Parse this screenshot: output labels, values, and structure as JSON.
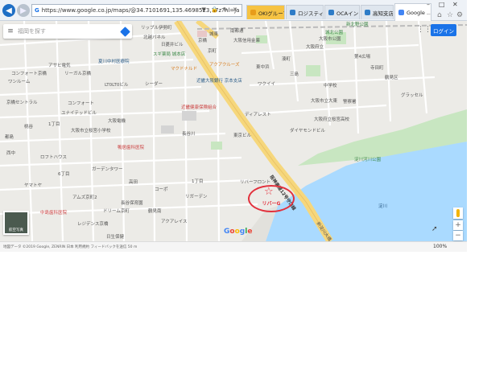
{
  "browser": {
    "url": "https://www.google.co.jp/maps/@34.7101691,135.4698523,17z?hl=ja",
    "tabs": [
      {
        "label": "OKIグループ...",
        "style": "hl",
        "icon_color": "#e89c1a"
      },
      {
        "label": "ロジスティ...",
        "style": "normal",
        "icon_color": "#2e7cc7"
      },
      {
        "label": "OCAイントラ",
        "style": "normal",
        "icon_color": "#2e7cc7"
      },
      {
        "label": "高知支店",
        "style": "normal",
        "icon_color": "#2e7cc7"
      },
      {
        "label": "Google ...",
        "style": "active",
        "icon_color": "#4285f4"
      }
    ],
    "tab_close": "×",
    "win_min": "–",
    "win_max": "□",
    "win_close": "✕",
    "addr_tools": "▼ 🔒 ↻ ✕",
    "home_icon": "⌂",
    "star_icon": "☆",
    "gear_icon": "⚙",
    "zoom": "100%"
  },
  "map": {
    "search_placeholder": "福岡を探す",
    "login_label": "ログイン",
    "satellite_label": "航空写真",
    "copyright": "地図データ ©2019 Google, ZENRIN 日本 利用規約 フィードバックを送信 50 m",
    "google_logo": "Google",
    "marker_label": "リバーG",
    "zoom_in": "+",
    "zoom_out": "−",
    "labels": [
      {
        "text": "リップル伊勢町",
        "cls": ""
      },
      {
        "text": "北越パネル",
        "cls": ""
      },
      {
        "text": "日菱井ビル",
        "cls": ""
      },
      {
        "text": "城東",
        "cls": ""
      },
      {
        "text": "南都通",
        "cls": ""
      },
      {
        "text": "大阪信用金庫",
        "cls": ""
      },
      {
        "text": "スギ薬局 城本店",
        "cls": "green"
      },
      {
        "text": "京町",
        "cls": ""
      },
      {
        "text": "夏川中村医療院",
        "cls": "blue"
      },
      {
        "text": "アクアクルーズ",
        "cls": "orange"
      },
      {
        "text": "マクドナルド",
        "cls": "orange"
      },
      {
        "text": "コンフォート京橋",
        "cls": ""
      },
      {
        "text": "アサヒ電気",
        "cls": ""
      },
      {
        "text": "リーガル京橋",
        "cls": ""
      },
      {
        "text": "ワンルーム",
        "cls": ""
      },
      {
        "text": "近畿大阪銀行 京本支店",
        "cls": "blue"
      },
      {
        "text": "近畿健康保険組合",
        "cls": "red"
      },
      {
        "text": "LT0LT0ビル",
        "cls": ""
      },
      {
        "text": "シーダー",
        "cls": ""
      },
      {
        "text": "コンフォート",
        "cls": ""
      },
      {
        "text": "ユナイテッドビル",
        "cls": ""
      },
      {
        "text": "京橋セントラル",
        "cls": ""
      },
      {
        "text": "大阪市立桜宮小学校",
        "cls": ""
      },
      {
        "text": "1丁目",
        "cls": ""
      },
      {
        "text": "桃谷",
        "cls": ""
      },
      {
        "text": "鴨居歯科医院",
        "cls": "red"
      },
      {
        "text": "長谷川",
        "cls": ""
      },
      {
        "text": "ロフトハウス",
        "cls": ""
      },
      {
        "text": "アムズ京町2",
        "cls": ""
      },
      {
        "text": "中島歯科医院",
        "cls": "red"
      },
      {
        "text": "ドリーム京町",
        "cls": ""
      },
      {
        "text": "高田",
        "cls": ""
      },
      {
        "text": "長谷保育園",
        "cls": ""
      },
      {
        "text": "リバーフロント",
        "cls": ""
      },
      {
        "text": "東京ビル",
        "cls": ""
      },
      {
        "text": "リガーデン",
        "cls": ""
      },
      {
        "text": "鶴見南",
        "cls": ""
      },
      {
        "text": "ダイヤモンドビル",
        "cls": ""
      },
      {
        "text": "淀川河川公園",
        "cls": "green"
      },
      {
        "text": "淀川",
        "cls": "blue"
      },
      {
        "text": "大阪府立",
        "cls": ""
      },
      {
        "text": "大阪市公園",
        "cls": ""
      },
      {
        "text": "城北公園",
        "cls": "green"
      },
      {
        "text": "新北野公園",
        "cls": "green"
      },
      {
        "text": "第4広場",
        "cls": ""
      },
      {
        "text": "大阪市立大東",
        "cls": ""
      },
      {
        "text": "警察署",
        "cls": ""
      },
      {
        "text": "グラッセル",
        "cls": ""
      },
      {
        "text": "ワクイイ",
        "cls": ""
      },
      {
        "text": "鶴見区",
        "cls": ""
      },
      {
        "text": "三島",
        "cls": ""
      },
      {
        "text": "湊町",
        "cls": ""
      },
      {
        "text": "東中浜",
        "cls": ""
      },
      {
        "text": "寺田町",
        "cls": ""
      },
      {
        "text": "中学校",
        "cls": ""
      },
      {
        "text": "大阪府立桜宮高校",
        "cls": ""
      },
      {
        "text": "ディアレスト",
        "cls": ""
      },
      {
        "text": "阪神高速12号守口線",
        "cls": "bold"
      },
      {
        "text": "新淀川大橋",
        "cls": ""
      },
      {
        "text": "大阪電機",
        "cls": ""
      },
      {
        "text": "都島",
        "cls": ""
      },
      {
        "text": "ヤマトヤ",
        "cls": ""
      },
      {
        "text": "レジデンス京橋",
        "cls": ""
      },
      {
        "text": "1丁目",
        "cls": ""
      },
      {
        "text": "コーポ",
        "cls": ""
      },
      {
        "text": "西中",
        "cls": ""
      },
      {
        "text": "6丁目",
        "cls": ""
      },
      {
        "text": "京橋",
        "cls": ""
      },
      {
        "text": "ガーデンタワー",
        "cls": ""
      },
      {
        "text": "アクアレイス",
        "cls": ""
      },
      {
        "text": "日生保健",
        "cls": ""
      }
    ]
  }
}
